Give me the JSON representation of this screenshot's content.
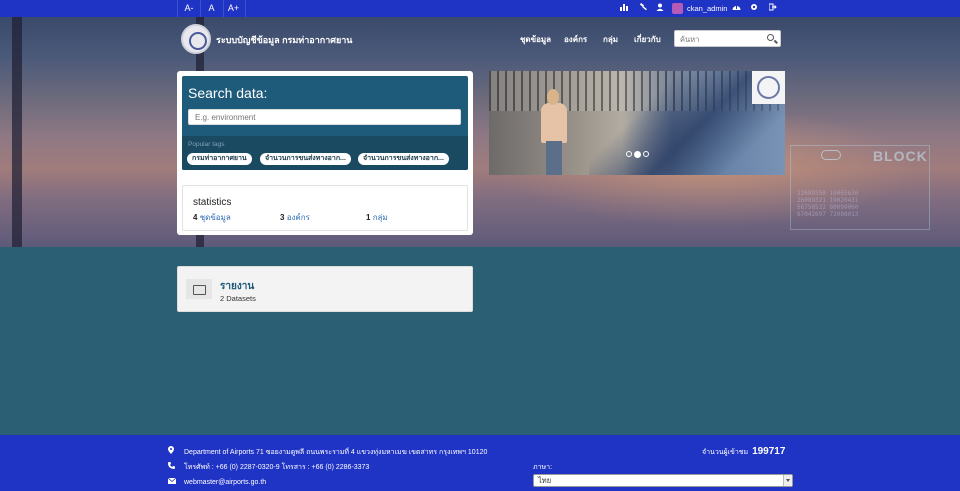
{
  "topbar": {
    "font_controls": [
      "A-",
      "A",
      "A+"
    ],
    "icons": [
      "chart-icon",
      "gavel-icon",
      "user-icon",
      "dashboard-icon",
      "gear-icon",
      "signout-icon"
    ],
    "username": "ckan_admin"
  },
  "masthead": {
    "site_title": "ระบบบัญชีข้อมูล กรมท่าอากาศยาน",
    "nav": [
      "ชุดข้อมูล",
      "องค์กร",
      "กลุ่ม",
      "เกี่ยวกับ"
    ],
    "search_placeholder": "ค้นหา"
  },
  "search_panel": {
    "heading": "Search data:",
    "placeholder": "E.g. environment",
    "popular_tags_label": "Popular tags",
    "tags": [
      "กรมท่าอากาศยาน",
      "จำนวนการขนส่งทางอาก...",
      "จำนวนการขนส่งทางอาก..."
    ]
  },
  "statistics": {
    "heading": "statistics",
    "items": [
      {
        "count": "4",
        "label": "ชุดข้อมูล"
      },
      {
        "count": "3",
        "label": "องค์กร"
      },
      {
        "count": "1",
        "label": "กลุ่ม"
      }
    ]
  },
  "carousel": {
    "slide_count": 3,
    "active_index": 1
  },
  "group": {
    "title": "รายงาน",
    "count": "2 Datasets"
  },
  "footer": {
    "address": "Department of Airports 71 ซอยงามดูพลี ถนนพระรามที่ 4 แขวงทุ่งมหาเมฆ เขตสาทร กรุงเทพฯ 10120",
    "phone": "โทรศัพท์ : +66 (0) 2287-0320-9 โทรสาร : +66 (0) 2286-3373",
    "email": "webmaster@airports.go.th",
    "visitors_label": "จำนวนผู้เข้าชม",
    "visitors_count": "199717",
    "language_label": "ภาษา:",
    "language_value": "ไทย"
  },
  "colors": {
    "topbar": "#1f33c4",
    "panel_dark": "#1e5a7a",
    "body_bg": "#2b5f73",
    "link": "#2f6db5"
  }
}
